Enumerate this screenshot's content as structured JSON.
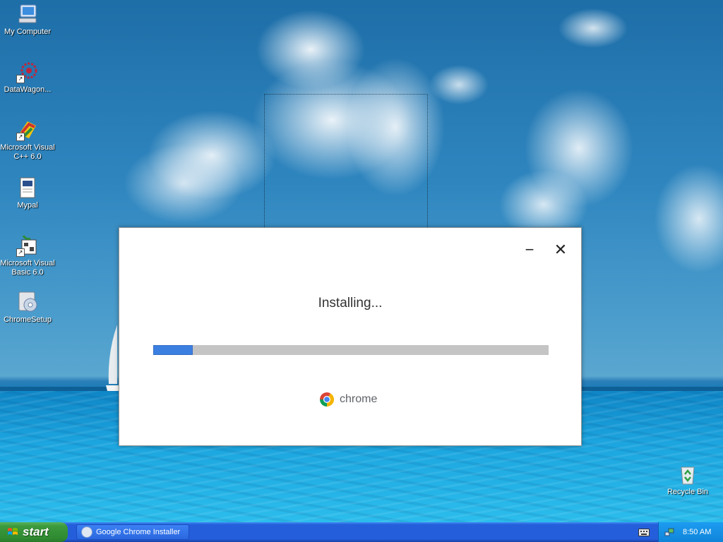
{
  "desktop": {
    "icons": [
      {
        "label": "My Computer"
      },
      {
        "label": "DataWagon..."
      },
      {
        "label": "Microsoft Visual C++ 6.0"
      },
      {
        "label": "Mypal"
      },
      {
        "label": "Microsoft Visual Basic 6.0"
      },
      {
        "label": "ChromeSetup"
      },
      {
        "label": "Recycle Bin"
      }
    ]
  },
  "installer": {
    "minimize_label": "−",
    "close_label": "✕",
    "status": "Installing...",
    "progress": 0.1,
    "brand": "chrome",
    "colors": {
      "progress_fill": "#3b7fe0",
      "progress_track": "#c4c4c4"
    }
  },
  "taskbar": {
    "start_label": "start",
    "task_label": "Google Chrome Installer",
    "time": "8:50 AM"
  }
}
